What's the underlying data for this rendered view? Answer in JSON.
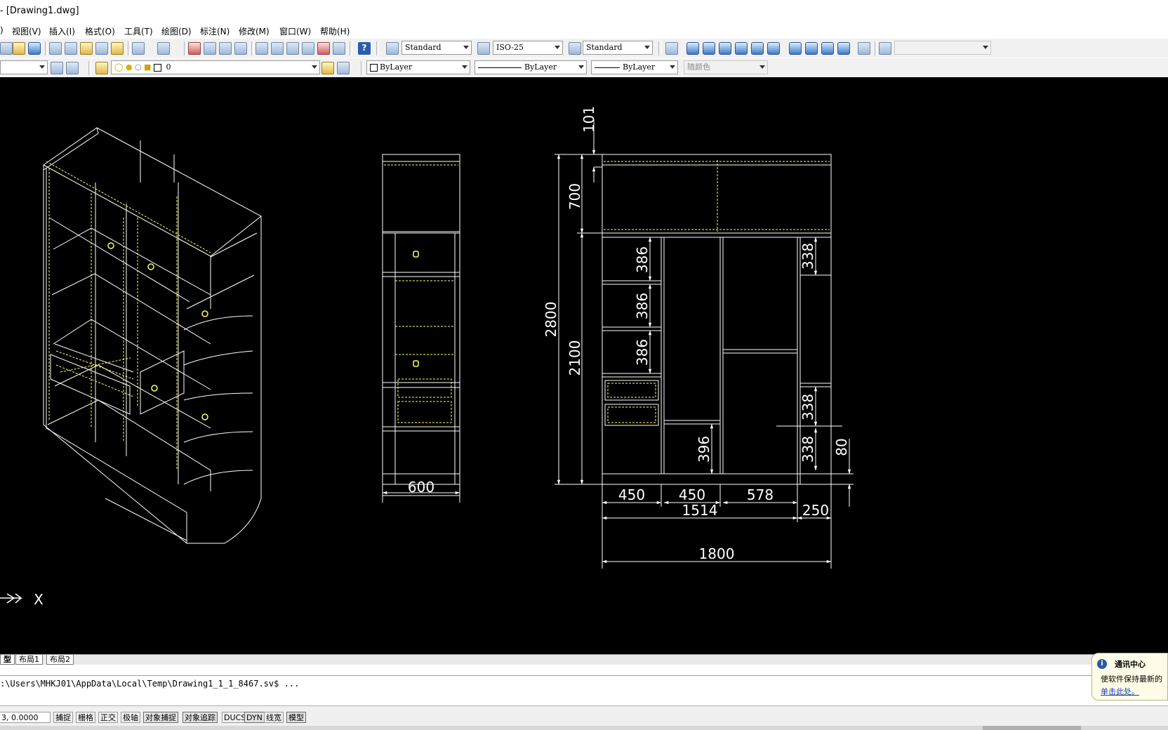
{
  "title": "- [Drawing1.dwg]",
  "menu": [
    ")",
    "视图(V)",
    "插入(I)",
    "格式(O)",
    "工具(T)",
    "绘图(D)",
    "标注(N)",
    "修改(M)",
    "窗口(W)",
    "帮助(H)"
  ],
  "toolbar1": {
    "text_style": "Standard",
    "dim_style": "ISO-25",
    "table_style": "Standard",
    "view_select": ""
  },
  "toolbar2": {
    "layer_name": "0",
    "color": "ByLayer",
    "linetype": "ByLayer",
    "lineweight": "ByLayer",
    "plot_style": "随颜色"
  },
  "drawing": {
    "front_view": {
      "dims": {
        "d101": "101",
        "d700": "700",
        "d2800": "2800",
        "d2100": "2100",
        "d386a": "386",
        "d386b": "386",
        "d386c": "386",
        "d338a": "338",
        "d338b": "338",
        "d338c": "338",
        "d396": "396",
        "d80": "80",
        "d450a": "450",
        "d450b": "450",
        "d578": "578",
        "d1514": "1514",
        "d250": "250",
        "d1800": "1800"
      }
    },
    "side_view": {
      "width_dim": "600"
    },
    "ucs_x_label": "X"
  },
  "tabs": [
    "型",
    "布局1",
    "布局2"
  ],
  "command_line": ":\\Users\\MHKJ01\\AppData\\Local\\Temp\\Drawing1_1_1_8467.sv$ ...",
  "status": {
    "coords": "3, 0.0000",
    "buttons": [
      "捕捉",
      "栅格",
      "正交",
      "极轴",
      "对象捕捉",
      "对象追踪",
      "DUCS",
      "DYN",
      "线宽",
      "模型"
    ],
    "on_buttons": [
      "对象捕捉",
      "对象追踪",
      "DYN",
      "模型"
    ]
  },
  "notification": {
    "title": "通讯中心",
    "body": "使软件保持最新的",
    "link": "单击此处。"
  },
  "colors": {
    "canvas_bg": "#000000",
    "lines": "#ffffff",
    "highlight": "#ffff66"
  }
}
